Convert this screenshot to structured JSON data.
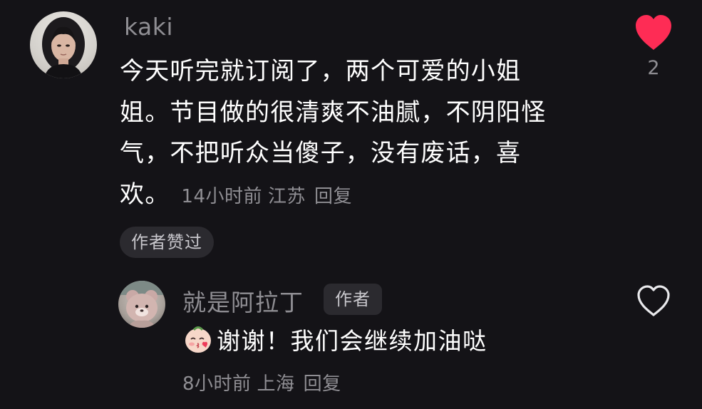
{
  "comment": {
    "username": "kaki",
    "text_lines": [
      "今天听完就订阅了，两个可爱的小姐",
      "姐。节目做的很清爽不油腻，不阴阳怪",
      "气，不把听众当傻子，没有废话，喜",
      "欢。"
    ],
    "time": "14小时前",
    "location": "江苏",
    "reply_label": "回复",
    "author_liked_label": "作者赞过",
    "like_count": "2",
    "liked": true,
    "heart_color": "#fe2c55"
  },
  "reply": {
    "username": "就是阿拉丁",
    "author_badge": "作者",
    "emoji_icon": "blowing-kiss-face-icon",
    "text": "谢谢！我们会继续加油哒",
    "time": "8小时前",
    "location": "上海",
    "reply_label": "回复",
    "liked": false
  },
  "colors": {
    "background": "#141317",
    "secondary_text": "#8f8e93",
    "chip_background": "#2b2a2f"
  }
}
